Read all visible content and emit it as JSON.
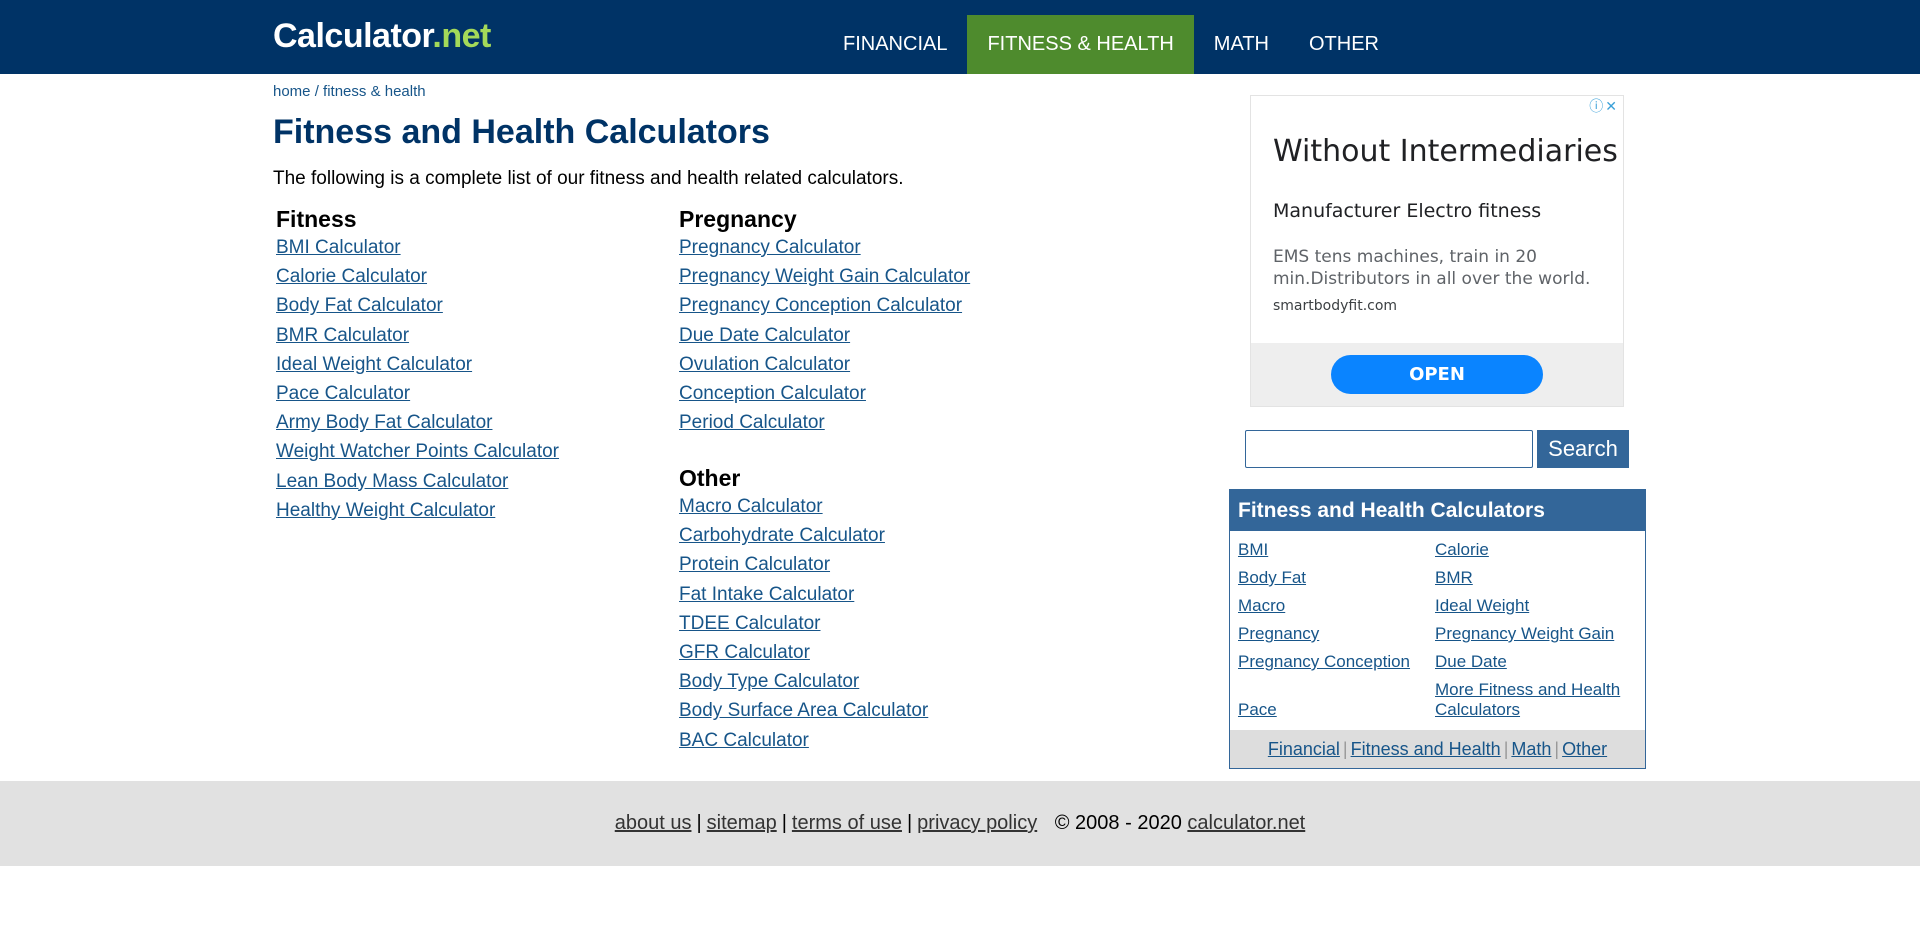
{
  "brand": {
    "part1": "Calculator",
    "part2": ".net"
  },
  "nav": {
    "items": [
      {
        "label": "FINANCIAL",
        "active": false
      },
      {
        "label": "FITNESS & HEALTH",
        "active": true
      },
      {
        "label": "MATH",
        "active": false
      },
      {
        "label": "OTHER",
        "active": false
      }
    ]
  },
  "breadcrumb": {
    "home": "home",
    "sep": " / ",
    "current": "fitness & health"
  },
  "page": {
    "title": "Fitness and Health Calculators",
    "intro": "The following is a complete list of our fitness and health related calculators."
  },
  "sections": {
    "fitness": {
      "heading": "Fitness",
      "links": [
        "BMI Calculator",
        "Calorie Calculator",
        "Body Fat Calculator",
        "BMR Calculator",
        "Ideal Weight Calculator",
        "Pace Calculator",
        "Army Body Fat Calculator",
        "Weight Watcher Points Calculator",
        "Lean Body Mass Calculator",
        "Healthy Weight Calculator"
      ]
    },
    "pregnancy": {
      "heading": "Pregnancy",
      "links": [
        "Pregnancy Calculator",
        "Pregnancy Weight Gain Calculator",
        "Pregnancy Conception Calculator",
        "Due Date Calculator",
        "Ovulation Calculator",
        "Conception Calculator",
        "Period Calculator"
      ]
    },
    "other": {
      "heading": "Other",
      "links": [
        "Macro Calculator",
        "Carbohydrate Calculator",
        "Protein Calculator",
        "Fat Intake Calculator",
        "TDEE Calculator",
        "GFR Calculator",
        "Body Type Calculator",
        "Body Surface Area Calculator",
        "BAC Calculator"
      ]
    }
  },
  "ad": {
    "headline": "Without Intermediaries",
    "subheadline": "Manufacturer Electro fitness",
    "description": "EMS tens machines, train in 20 min.Distributors in all over the world.",
    "domain": "smartbodyfit.com",
    "cta": "OPEN",
    "info_glyph": "ⓘ",
    "close_glyph": "✕"
  },
  "search": {
    "placeholder": "",
    "value": "",
    "button": "Search"
  },
  "sidebar": {
    "title": "Fitness and Health Calculators",
    "rows": [
      [
        "BMI",
        "Calorie"
      ],
      [
        "Body Fat",
        "BMR"
      ],
      [
        "Macro",
        "Ideal Weight"
      ],
      [
        "Pregnancy",
        "Pregnancy Weight Gain"
      ],
      [
        "Pregnancy Conception",
        "Due Date"
      ],
      [
        "Pace",
        "More Fitness and Health Calculators"
      ]
    ],
    "footer_links": [
      "Financial",
      "Fitness and Health",
      "Math",
      "Other"
    ],
    "footer_sep": "|"
  },
  "footer": {
    "links": [
      "about us",
      "sitemap",
      "terms of use",
      "privacy policy"
    ],
    "sep": "|",
    "copyright": "© 2008 - 2020",
    "site": "calculator.net"
  },
  "colors": {
    "header_bg": "#003366",
    "nav_active_bg": "#4e8b2d",
    "logo_accent": "#a3d959",
    "link": "#175589",
    "box_header_bg": "#336699",
    "footer_bg": "#e1e1e1",
    "ad_cta": "#0a84ff"
  }
}
